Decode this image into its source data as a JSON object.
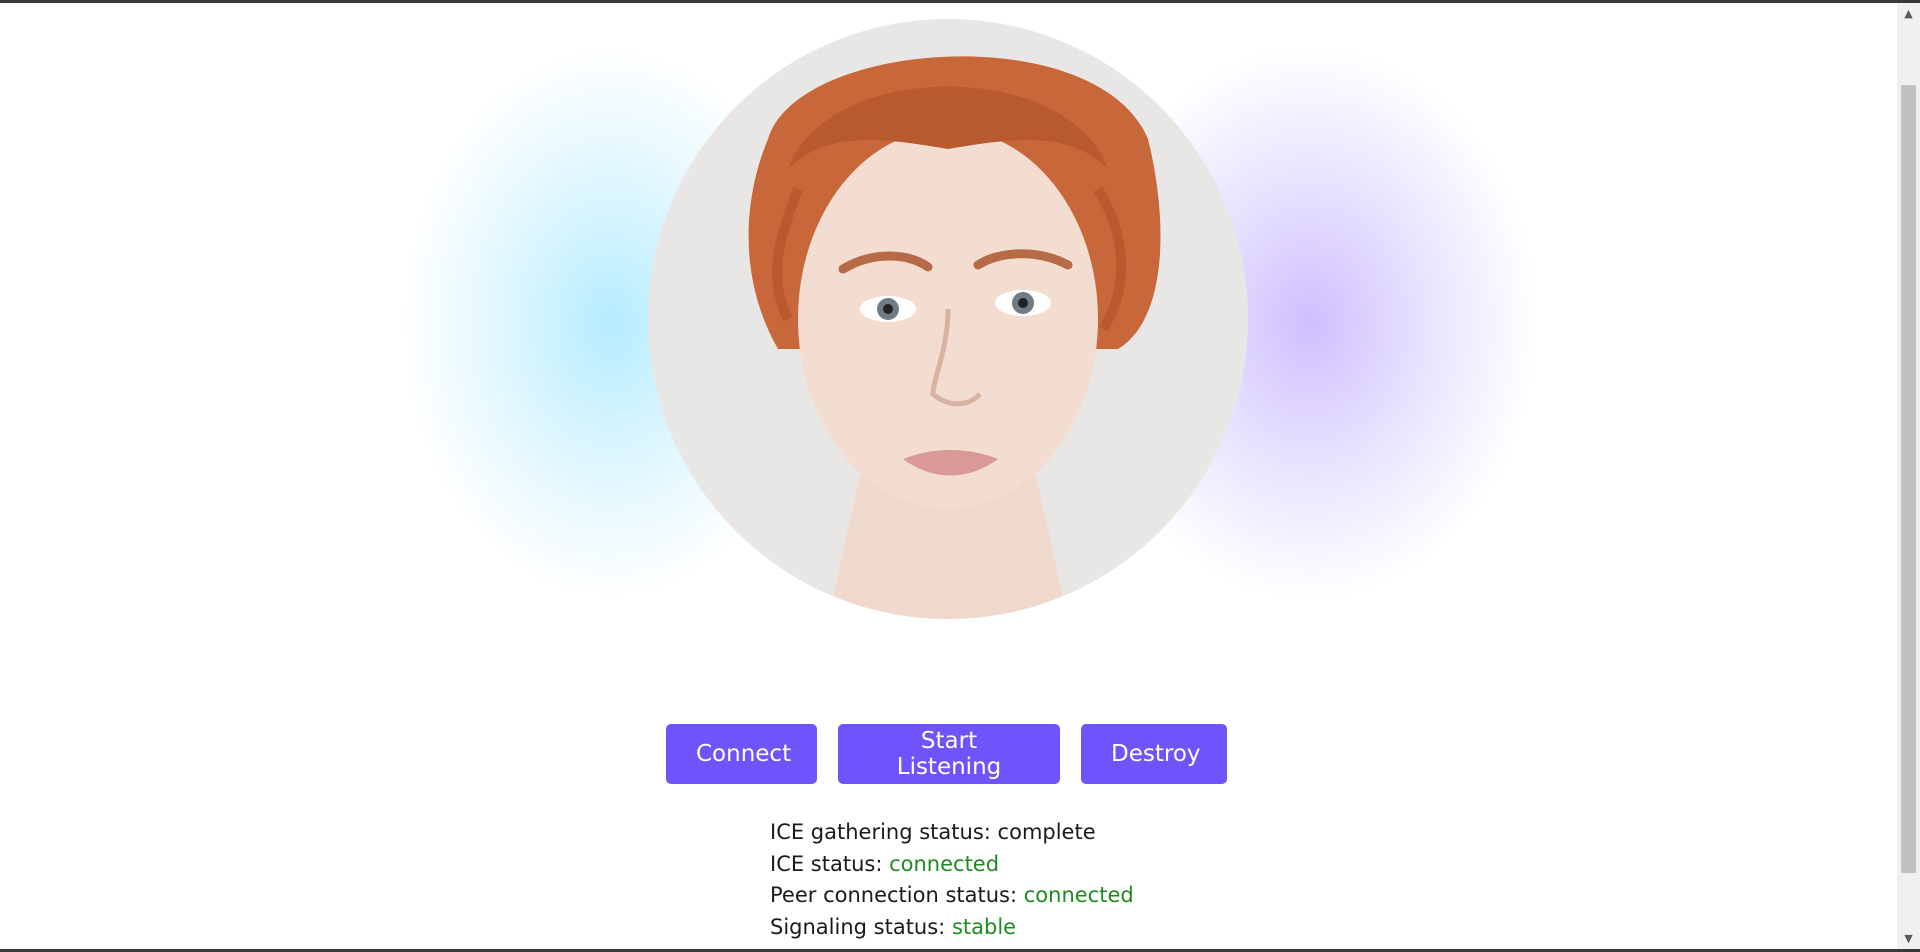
{
  "buttons": {
    "connect": "Connect",
    "start_listening": "Start Listening",
    "destroy": "Destroy"
  },
  "status": {
    "ice_gathering_label": "ICE gathering status:",
    "ice_gathering_value": "complete",
    "ice_label": "ICE status:",
    "ice_value": "connected",
    "peer_label": "Peer connection status:",
    "peer_value": "connected",
    "signaling_label": "Signaling status:",
    "signaling_value": "stable"
  },
  "colors": {
    "button_bg": "#6e55fb",
    "status_ok": "#1f8a1f",
    "glow_left": "#78dcff",
    "glow_right": "#a58cff"
  },
  "icons": {
    "scroll_up": "▲",
    "scroll_down": "▼"
  }
}
